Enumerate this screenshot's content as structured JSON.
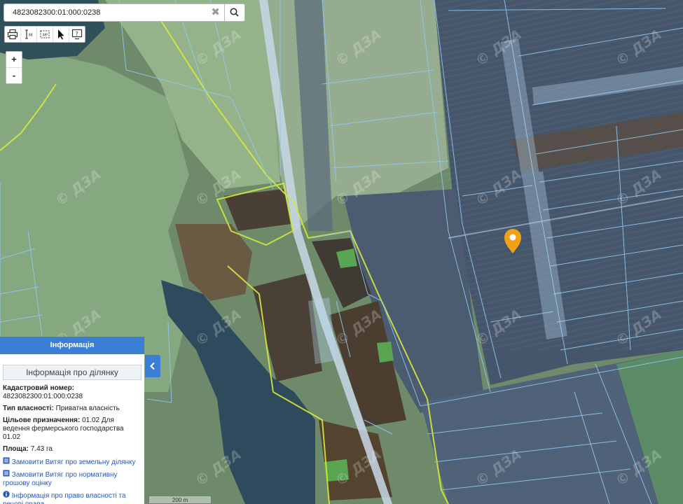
{
  "search": {
    "value": "4823082300:01:000:0238",
    "clear_symbol": "✖"
  },
  "zoom": {
    "in": "+",
    "out": "-"
  },
  "watermark": "© ДЗА",
  "marker_color": "#f0a116",
  "scale_label": "200 m",
  "info_panel": {
    "header": "Інформація",
    "subtitle": "Інформація про ділянку",
    "cadastral_label": "Кадастровий номер:",
    "cadastral_value": "4823082300:01:000:0238",
    "ownership_label": "Тип власності:",
    "ownership_value": "Приватна власність",
    "purpose_label": "Цільове призначення:",
    "purpose_value": "01.02 Для ведення фермерського господарства 01.02",
    "area_label": "Площа:",
    "area_value": "7.43 га",
    "link_extract": "Замовити Витяг про земельну ділянку",
    "link_valuation": "Замовити Витяг про нормативну грошову оцінку",
    "link_rights": "Інформація про право власності та речові права"
  }
}
